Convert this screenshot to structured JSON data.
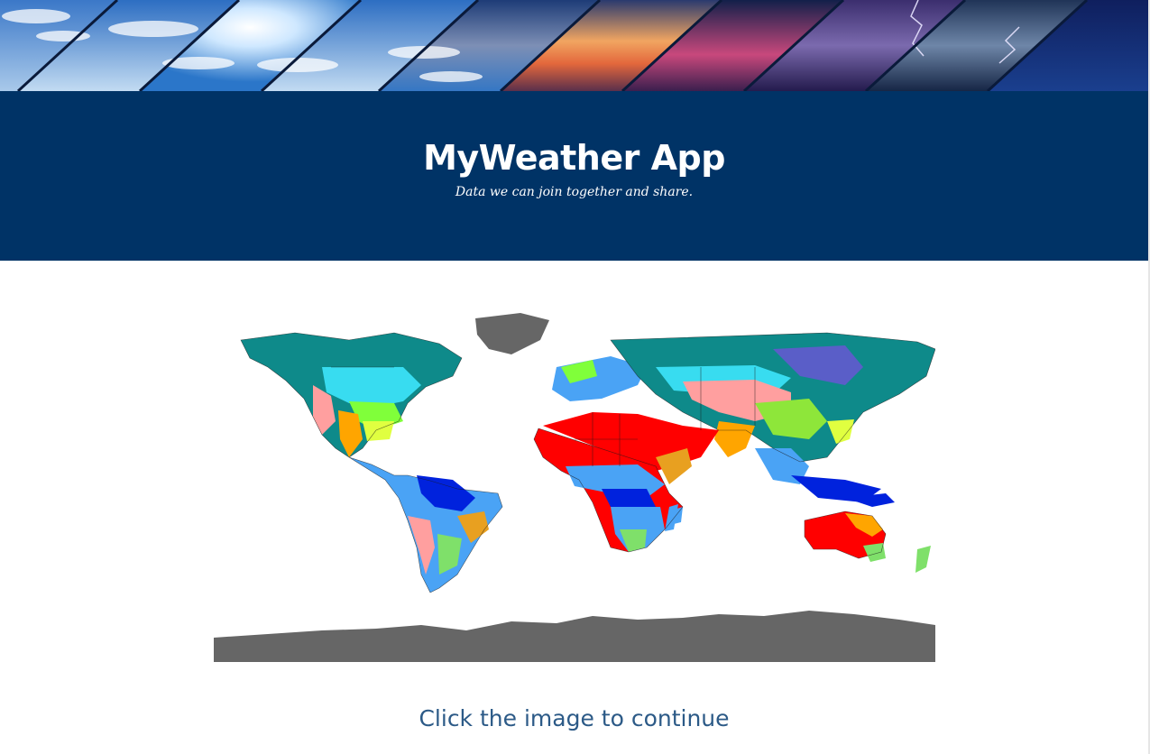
{
  "header": {
    "title": "MyWeather App",
    "tagline": "Data we can join together and share."
  },
  "main": {
    "map_image": "world-climate-map",
    "call_to_action": "Click the image to continue"
  },
  "colors": {
    "hero_background": "#003366",
    "cta_text": "#2c5a87"
  }
}
